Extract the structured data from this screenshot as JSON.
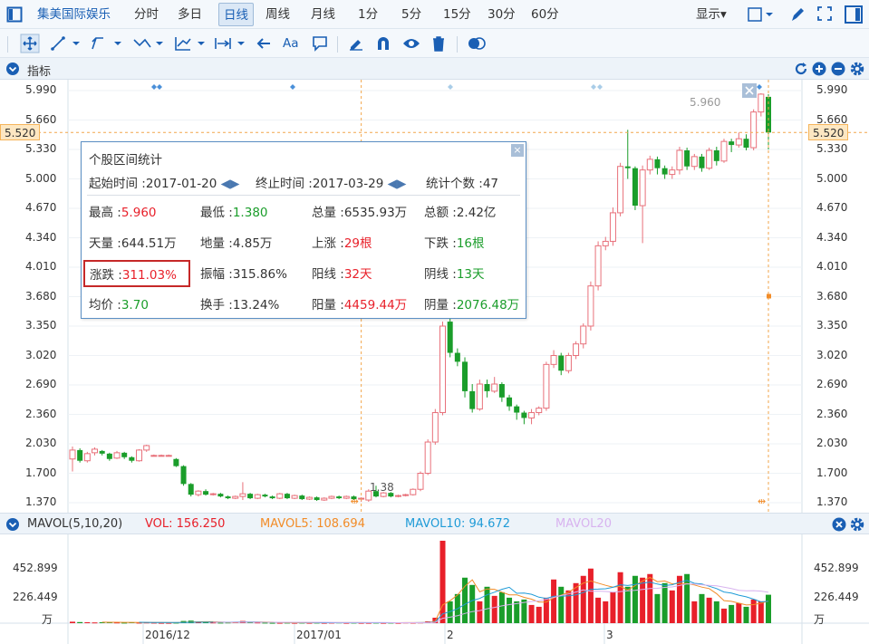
{
  "toolbar": {
    "stock_name": "集美国际娱乐",
    "periods": [
      "分时",
      "多日",
      "日线",
      "周线",
      "月线",
      "1分",
      "5分",
      "15分",
      "30分",
      "60分"
    ],
    "active_period": "日线",
    "display_label": "显示▾",
    "text_tool_label": "Aa"
  },
  "indicator_bar": {
    "label": "指标"
  },
  "price_axis": {
    "ticks": [
      "5.990",
      "5.660",
      "5.330",
      "5.000",
      "4.670",
      "4.340",
      "4.010",
      "3.680",
      "3.350",
      "3.020",
      "2.690",
      "2.360",
      "2.030",
      "1.700",
      "1.370"
    ],
    "current_price": "5.520"
  },
  "annotations": {
    "high_label": "5.960",
    "low_label": "1.38"
  },
  "popup": {
    "title": "个股区间统计",
    "close": "×",
    "start_label": "起始时间 :2017-01-20",
    "end_label": "终止时间 :2017-03-29",
    "count_label": "统计个数 :47",
    "rows": [
      [
        {
          "k": "最高 :",
          "v": "5.960",
          "c": "red"
        },
        {
          "k": "最低 :",
          "v": "1.380",
          "c": "green"
        },
        {
          "k": "总量 :",
          "v": "6535.93万",
          "c": ""
        },
        {
          "k": "总额 :",
          "v": "2.42亿",
          "c": ""
        }
      ],
      [
        {
          "k": "天量 :",
          "v": "644.51万",
          "c": ""
        },
        {
          "k": "地量 :",
          "v": "4.85万",
          "c": ""
        },
        {
          "k": "上涨 :",
          "v": "29根",
          "c": "red"
        },
        {
          "k": "下跌 :",
          "v": "16根",
          "c": "green"
        }
      ],
      [
        {
          "k": "涨跌 :",
          "v": "311.03%",
          "c": "red"
        },
        {
          "k": "振幅 :",
          "v": "315.86%",
          "c": ""
        },
        {
          "k": "阳线 :",
          "v": "32天",
          "c": "red"
        },
        {
          "k": "阴线 :",
          "v": "13天",
          "c": "green"
        }
      ],
      [
        {
          "k": "均价 :",
          "v": "3.70",
          "c": "green"
        },
        {
          "k": "换手 :",
          "v": "13.24%",
          "c": ""
        },
        {
          "k": "阳量 :",
          "v": "4459.44万",
          "c": "red"
        },
        {
          "k": "阴量 :",
          "v": "2076.48万",
          "c": "green"
        }
      ]
    ]
  },
  "volume_bar": {
    "name": "MAVOL(5,10,20)",
    "vol": "VOL: 156.250",
    "mavol5": "MAVOL5: 108.694",
    "mavol10": "MAVOL10: 94.672",
    "mavol20": "MAVOL20"
  },
  "volume_axis": {
    "ticks": [
      "452.899",
      "226.449"
    ],
    "unit": "万"
  },
  "date_axis": [
    "2016/12",
    "2017/01",
    "2",
    "3"
  ],
  "colors": {
    "up": "#e8202a",
    "down": "#1a9d2a",
    "accent": "#1a5fb4",
    "ma5": "#f28c28",
    "ma10": "#1f9bd7",
    "ma20": "#d8b3ef"
  },
  "chart_data": {
    "type": "candlestick",
    "ylim": [
      1.37,
      5.99
    ],
    "candles": [
      [
        1.86,
        1.96,
        1.72,
        2.0
      ],
      [
        1.96,
        1.84,
        1.82,
        1.98
      ],
      [
        1.84,
        1.92,
        1.82,
        1.94
      ],
      [
        1.93,
        1.97,
        1.9,
        1.99
      ],
      [
        1.95,
        1.92,
        1.9,
        1.96
      ],
      [
        1.92,
        1.86,
        1.84,
        1.93
      ],
      [
        1.87,
        1.93,
        1.86,
        1.95
      ],
      [
        1.93,
        1.88,
        1.86,
        1.94
      ],
      [
        1.88,
        1.84,
        1.82,
        1.89
      ],
      [
        1.84,
        1.96,
        1.83,
        1.97
      ],
      [
        1.96,
        2.01,
        1.94,
        2.02
      ],
      [
        1.9,
        1.9,
        1.9,
        1.91
      ],
      [
        1.9,
        1.9,
        1.9,
        1.91
      ],
      [
        1.9,
        1.9,
        1.9,
        1.91
      ],
      [
        1.86,
        1.78,
        1.77,
        1.87
      ],
      [
        1.78,
        1.58,
        1.56,
        1.79
      ],
      [
        1.58,
        1.46,
        1.44,
        1.59
      ],
      [
        1.46,
        1.5,
        1.44,
        1.51
      ],
      [
        1.5,
        1.46,
        1.45,
        1.52
      ],
      [
        1.46,
        1.47,
        1.45,
        1.48
      ],
      [
        1.47,
        1.44,
        1.43,
        1.48
      ],
      [
        1.44,
        1.42,
        1.41,
        1.45
      ],
      [
        1.42,
        1.44,
        1.41,
        1.45
      ],
      [
        1.44,
        1.47,
        1.4,
        1.6
      ],
      [
        1.47,
        1.42,
        1.41,
        1.48
      ],
      [
        1.42,
        1.46,
        1.41,
        1.47
      ],
      [
        1.46,
        1.44,
        1.43,
        1.47
      ],
      [
        1.44,
        1.42,
        1.41,
        1.45
      ],
      [
        1.42,
        1.47,
        1.41,
        1.48
      ],
      [
        1.47,
        1.42,
        1.41,
        1.48
      ],
      [
        1.42,
        1.45,
        1.41,
        1.46
      ],
      [
        1.45,
        1.41,
        1.4,
        1.46
      ],
      [
        1.41,
        1.43,
        1.4,
        1.44
      ],
      [
        1.43,
        1.4,
        1.39,
        1.44
      ],
      [
        1.4,
        1.42,
        1.39,
        1.43
      ],
      [
        1.42,
        1.44,
        1.41,
        1.45
      ],
      [
        1.44,
        1.42,
        1.41,
        1.45
      ],
      [
        1.42,
        1.44,
        1.41,
        1.45
      ],
      [
        1.44,
        1.41,
        1.4,
        1.45
      ],
      [
        1.41,
        1.42,
        1.38,
        1.43
      ],
      [
        1.4,
        1.5,
        1.38,
        1.52
      ],
      [
        1.5,
        1.44,
        1.43,
        1.56
      ],
      [
        1.44,
        1.48,
        1.43,
        1.49
      ],
      [
        1.48,
        1.44,
        1.43,
        1.49
      ],
      [
        1.44,
        1.45,
        1.43,
        1.46
      ],
      [
        1.45,
        1.46,
        1.44,
        1.47
      ],
      [
        1.46,
        1.52,
        1.45,
        1.53
      ],
      [
        1.52,
        1.7,
        1.5,
        1.72
      ],
      [
        1.7,
        2.05,
        1.68,
        2.08
      ],
      [
        2.05,
        2.38,
        2.02,
        2.42
      ],
      [
        2.38,
        3.35,
        2.35,
        3.4
      ],
      [
        3.4,
        3.05,
        3.0,
        3.6
      ],
      [
        3.05,
        2.95,
        2.9,
        3.1
      ],
      [
        2.95,
        2.62,
        2.55,
        3.0
      ],
      [
        2.62,
        2.42,
        2.38,
        2.7
      ],
      [
        2.42,
        2.7,
        2.4,
        2.75
      ],
      [
        2.7,
        2.62,
        2.55,
        2.75
      ],
      [
        2.62,
        2.7,
        2.6,
        2.78
      ],
      [
        2.7,
        2.55,
        2.5,
        2.72
      ],
      [
        2.55,
        2.45,
        2.4,
        2.58
      ],
      [
        2.45,
        2.38,
        2.3,
        2.47
      ],
      [
        2.38,
        2.32,
        2.25,
        2.4
      ],
      [
        2.32,
        2.38,
        2.25,
        2.42
      ],
      [
        2.38,
        2.43,
        2.35,
        2.45
      ],
      [
        2.43,
        2.92,
        2.4,
        2.95
      ],
      [
        2.92,
        3.02,
        2.88,
        3.08
      ],
      [
        3.02,
        2.85,
        2.8,
        3.05
      ],
      [
        2.85,
        3.02,
        2.82,
        3.05
      ],
      [
        3.02,
        3.15,
        2.98,
        3.18
      ],
      [
        3.15,
        3.35,
        3.1,
        3.38
      ],
      [
        3.35,
        3.8,
        3.3,
        3.85
      ],
      [
        3.8,
        4.25,
        3.75,
        4.3
      ],
      [
        4.25,
        4.3,
        4.2,
        4.35
      ],
      [
        4.3,
        4.62,
        4.25,
        4.68
      ],
      [
        4.62,
        5.14,
        4.58,
        5.18
      ],
      [
        5.14,
        5.12,
        5.0,
        5.55
      ],
      [
        5.12,
        4.7,
        4.65,
        5.14
      ],
      [
        4.7,
        5.1,
        4.28,
        5.15
      ],
      [
        5.1,
        5.22,
        5.05,
        5.26
      ],
      [
        5.22,
        5.12,
        5.05,
        5.25
      ],
      [
        5.12,
        5.05,
        5.0,
        5.15
      ],
      [
        5.05,
        5.1,
        5.0,
        5.14
      ],
      [
        5.1,
        5.32,
        5.05,
        5.36
      ],
      [
        5.32,
        5.14,
        5.1,
        5.35
      ],
      [
        5.14,
        5.25,
        5.1,
        5.28
      ],
      [
        5.25,
        5.12,
        5.08,
        5.28
      ],
      [
        5.12,
        5.32,
        5.1,
        5.35
      ],
      [
        5.32,
        5.2,
        5.15,
        5.36
      ],
      [
        5.2,
        5.42,
        5.18,
        5.45
      ],
      [
        5.42,
        5.38,
        5.3,
        5.45
      ],
      [
        5.38,
        5.45,
        5.35,
        5.52
      ],
      [
        5.45,
        5.35,
        5.32,
        5.5
      ],
      [
        5.35,
        5.75,
        5.32,
        5.78
      ],
      [
        5.75,
        5.95,
        5.7,
        5.96
      ],
      [
        5.92,
        5.52,
        5.33,
        5.95
      ]
    ],
    "volumes": [
      8,
      6,
      5,
      4,
      5,
      6,
      4,
      3,
      5,
      3,
      4,
      3,
      2,
      2,
      3,
      12,
      14,
      6,
      5,
      4,
      3,
      4,
      5,
      12,
      6,
      4,
      3,
      2,
      2,
      3,
      2,
      3,
      2,
      3,
      2,
      3,
      4,
      2,
      3,
      2,
      2,
      3,
      2,
      3,
      2,
      4,
      3,
      4,
      10,
      30,
      452.9,
      120,
      160,
      250,
      210,
      120,
      200,
      150,
      170,
      140,
      120,
      130,
      100,
      90,
      140,
      240,
      200,
      180,
      220,
      260,
      300,
      140,
      120,
      170,
      280,
      200,
      260,
      250,
      270,
      160,
      220,
      180,
      260,
      270,
      120,
      160,
      140,
      120,
      80,
      100,
      110,
      90,
      130,
      120,
      156.25
    ],
    "mavol_labels": [
      "MAVOL5",
      "MAVOL10",
      "MAVOL20"
    ]
  }
}
